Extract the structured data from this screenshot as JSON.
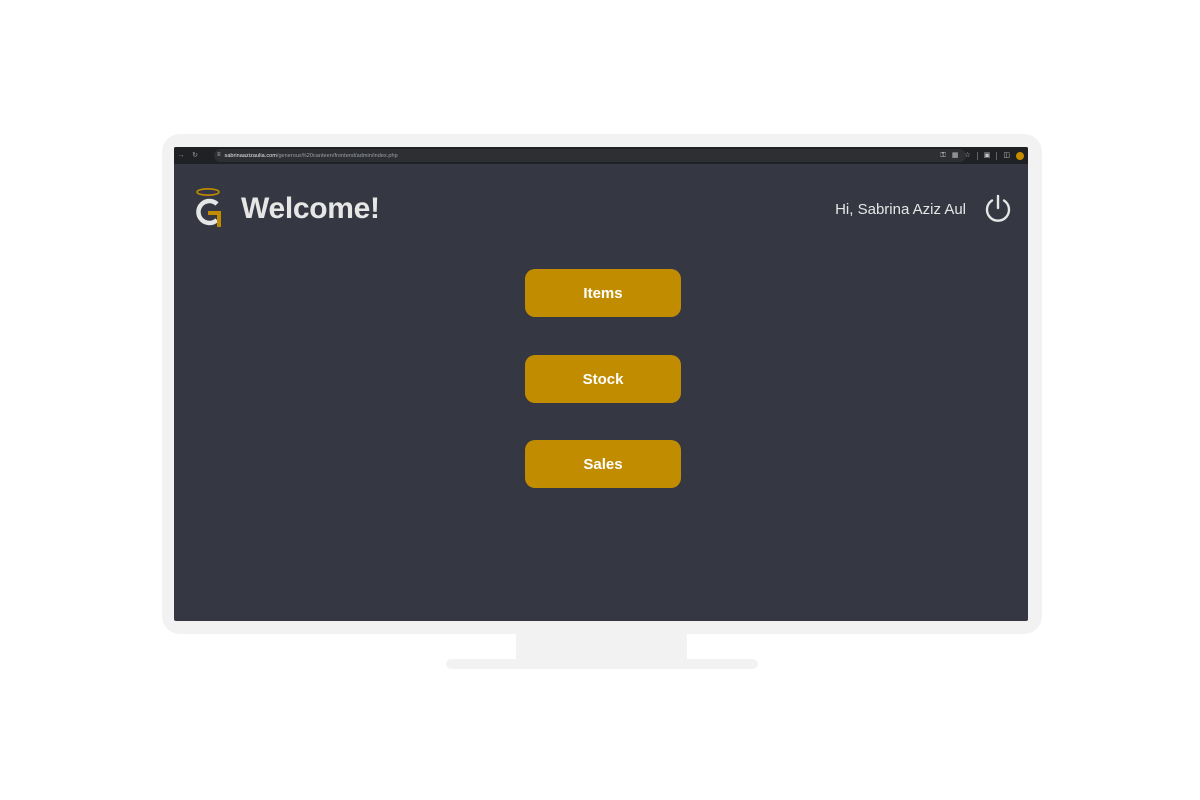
{
  "browser": {
    "back_icon": "arrow-right-icon",
    "reload_icon": "reload-icon",
    "url_host": "sabrinaazizaulia.com",
    "url_path": "/generous%20canteen/frontend/admin/index.php",
    "toolbar_icons": [
      "key-icon",
      "translate-icon",
      "star-icon",
      "extension-icon",
      "sidepanel-icon",
      "profile-icon"
    ]
  },
  "header": {
    "title": "Welcome!",
    "greeting": "Hi, Sabrina Aziz Aul",
    "logo_icon": "halo-g-logo-icon",
    "power_icon": "power-icon"
  },
  "menu": {
    "items_label": "Items",
    "stock_label": "Stock",
    "sales_label": "Sales"
  },
  "colors": {
    "background": "#353842",
    "accent": "#c18c00",
    "text": "#e6e6e6"
  }
}
